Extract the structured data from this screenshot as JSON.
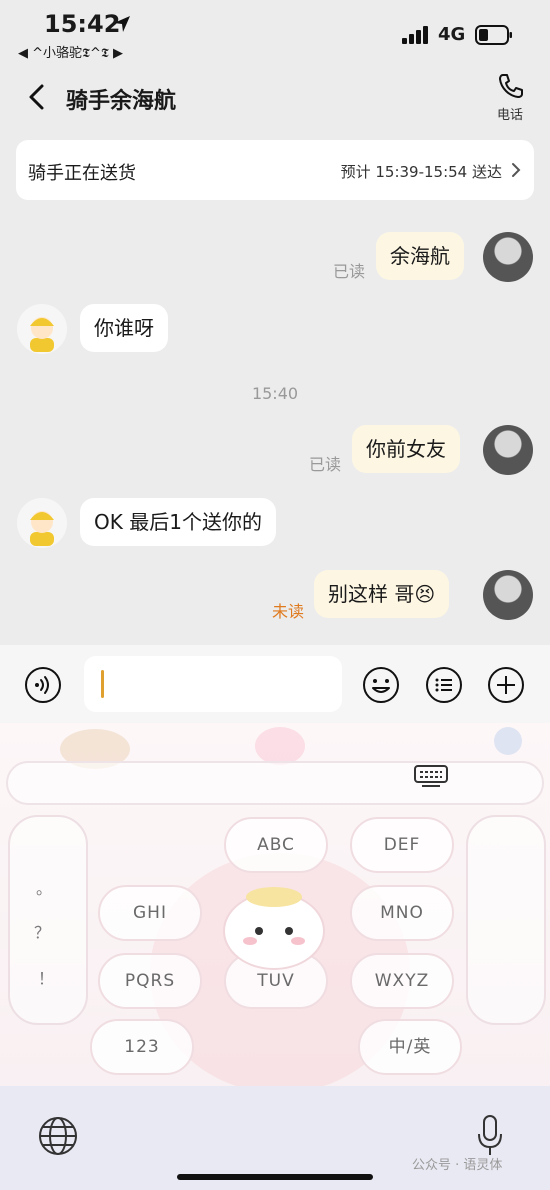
{
  "status_bar": {
    "time": "15:42",
    "back_to_app": "◀ ^小骆驼𝕿^𝕿 ▶",
    "network": "4G"
  },
  "nav": {
    "title": "骑手余海航",
    "phone_label": "电话"
  },
  "delivery": {
    "status": "骑手正在送货",
    "eta": "预计 15:39-15:54 送达"
  },
  "messages": [
    {
      "sender": "me",
      "text": "余海航",
      "receipt": "已读"
    },
    {
      "sender": "rider",
      "text": "你谁呀"
    },
    {
      "sender": "me",
      "text": "你前女友",
      "receipt": "已读"
    },
    {
      "sender": "rider",
      "text": "OK  最后1个送你的"
    },
    {
      "sender": "me",
      "text": "别这样 哥😣",
      "receipt": "未读"
    }
  ],
  "timestamp": "15:40",
  "keyboard": {
    "keys": [
      "ABC",
      "DEF",
      "GHI",
      "MNO",
      "PQRS",
      "TUV",
      "WXYZ",
      "123",
      "中/英"
    ],
    "side_keys": [
      "。",
      "？",
      "！"
    ]
  },
  "watermark": "公众号 · 语灵体",
  "colors": {
    "my_bubble": "#fdf6e3",
    "rider_bubble": "#ffffff",
    "unread": "#e07a1f",
    "caret": "#e0a030"
  }
}
